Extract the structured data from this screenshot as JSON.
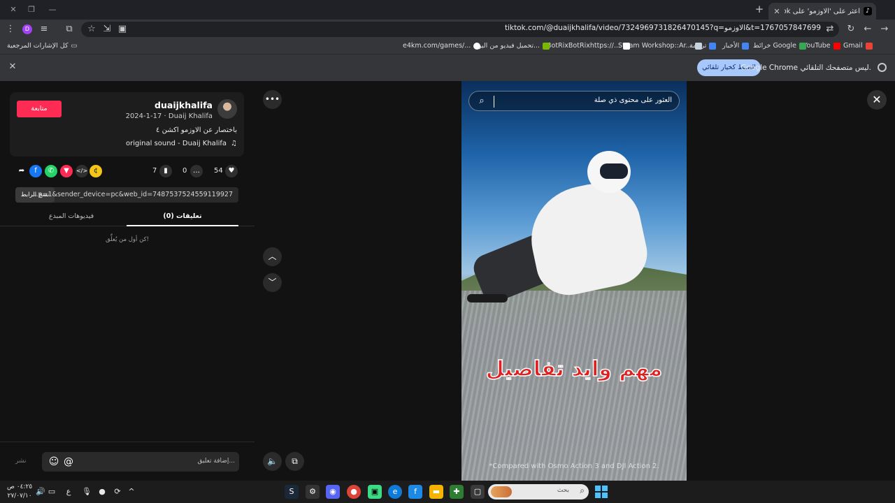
{
  "browser": {
    "tab_title": "اعثر على 'الاوزمو' على TikTok",
    "url": "tiktok.com/@duaijkhalifa/video/7324969731826470145?q=الاوزمو&t=1767057847699",
    "profile_initial": "D",
    "bookmarks": [
      {
        "label": "Gmail",
        "color": "#ea4335"
      },
      {
        "label": "YouTube",
        "color": "#ff0000"
      },
      {
        "label": "خرائط Google",
        "color": "#34a853"
      },
      {
        "label": "الأخبار",
        "color": "#4285f4"
      },
      {
        "label": "ترجمة",
        "color": "#4285f4"
      },
      {
        "label": "Steam Workshop::Ar...",
        "color": "#1b2838"
      },
      {
        "label": "BotRixBotRixhttps://...",
        "color": "#ffffff"
      },
      {
        "label": "تحميل فيديو من اليو...",
        "color": "#76b900"
      },
      {
        "label": "e4km.com/games/...",
        "color": "#ffffff"
      }
    ],
    "all_bookmarks_label": "كل الإشارات المرجعية",
    "infobar_text": "Google Chrome ليس متصفحك التلقائي.",
    "infobar_button": "الضبط كخيار تلقائي"
  },
  "post": {
    "follow_label": "متابعة",
    "username": "duaijkhalifa",
    "meta": "2024-1-17 · Duaij Khalifa",
    "description": "باختصار عن الاوزمو اكشن ٤",
    "sound": "original sound - Duaij Khalifa",
    "likes": "54",
    "comments": "0",
    "saves": "7",
    "share_link": "...p=1&sender_device=pc&web_id=7487537524559119927",
    "copy_link_label": "نسخ الرابط",
    "tab_comments": "تعليقات (0)",
    "tab_creator_videos": "فيديوهات المبدع",
    "empty_comments": "كن أول من يُعلِّق!",
    "comment_placeholder": "إضافة تعليق...",
    "post_label": "نشر"
  },
  "video": {
    "search_placeholder": "العثور على محتوى ذي صلة",
    "caption": "مهم وايد تفاصيل",
    "disclaimer": "*Compared with Osmo Action 3 and DJI Action 2."
  },
  "taskbar": {
    "time": "٠٤:٢٥ ص",
    "date": "٢٧/٠٧/١٠",
    "lang": "ع",
    "search_label": "بحث"
  }
}
